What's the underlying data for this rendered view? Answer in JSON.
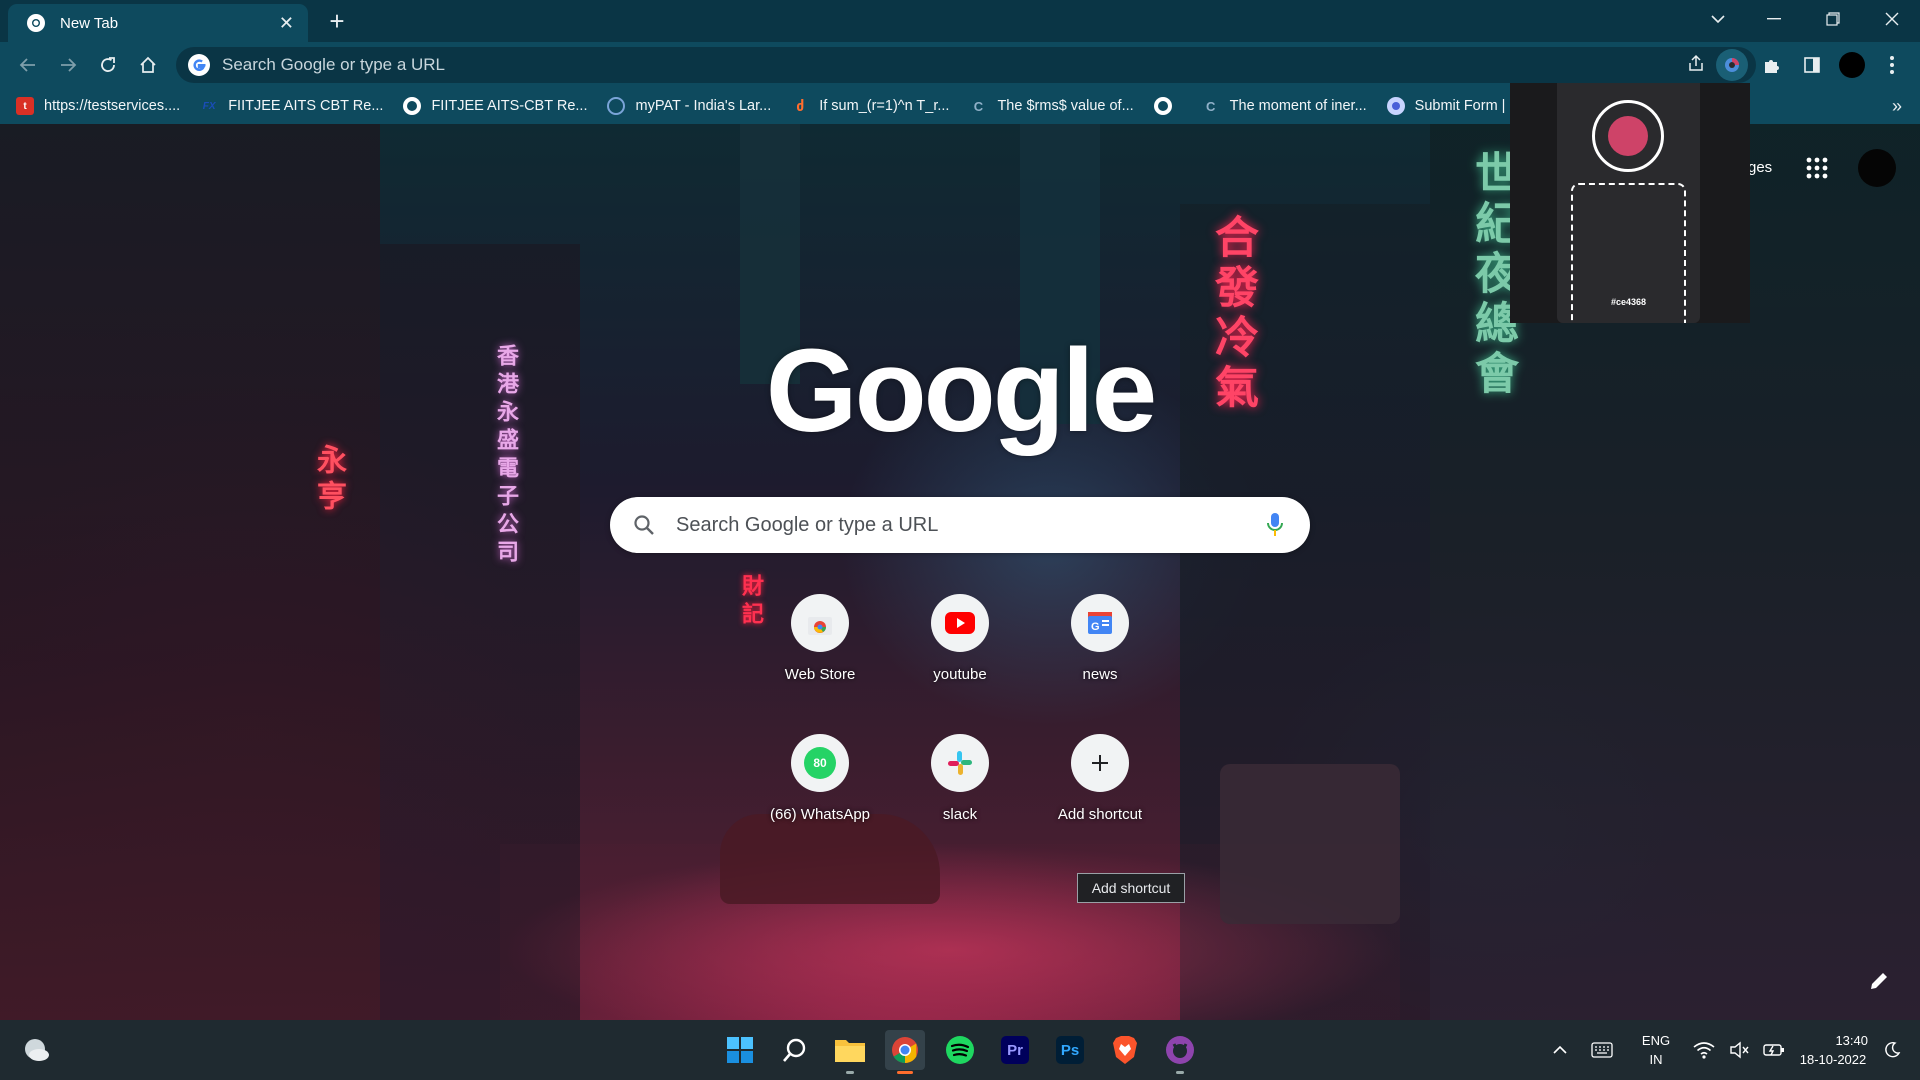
{
  "browser": {
    "tab": {
      "title": "New Tab"
    },
    "omnibox": {
      "placeholder": "Search Google or type a URL"
    },
    "bookmarks": [
      {
        "label": "https://testservices....",
        "icon": "red-doc-icon",
        "color": "#d93025"
      },
      {
        "label": "FIITJEE AITS CBT Re...",
        "icon": "fx-icon",
        "color": "#1a4db8"
      },
      {
        "label": "FIITJEE AITS-CBT Re...",
        "icon": "globe-icon",
        "color": "#ffffff"
      },
      {
        "label": "myPAT - India's Lar...",
        "icon": "mypat-icon",
        "color": "#7aa4d8"
      },
      {
        "label": "If sum_(r=1)^n T_r...",
        "icon": "doubtnut-icon",
        "color": "#ff6d2d"
      },
      {
        "label": "The $rms$ value of...",
        "icon": "quora-icon",
        "color": "#8fb0c8"
      },
      {
        "label": "",
        "icon": "globe-icon",
        "color": "#ffffff"
      },
      {
        "label": "The moment of iner...",
        "icon": "quora-icon",
        "color": "#8fb0c8"
      },
      {
        "label": "Submit Form | S",
        "icon": "form-icon",
        "color": "#c8d4ff"
      }
    ],
    "bookmarks_more": "»"
  },
  "ntp": {
    "logo": "Google",
    "search_placeholder": "Search Google or type a URL",
    "images_link": "ges",
    "shortcuts": [
      {
        "label": "Web Store",
        "icon": "chrome-webstore-icon"
      },
      {
        "label": "youtube",
        "icon": "youtube-icon"
      },
      {
        "label": "news",
        "icon": "google-news-icon"
      },
      {
        "label": "(66) WhatsApp",
        "icon": "whatsapp-icon",
        "badge": "80"
      },
      {
        "label": "slack",
        "icon": "slack-icon"
      },
      {
        "label": "Add shortcut",
        "icon": "plus-icon"
      }
    ],
    "tooltip": "Add shortcut"
  },
  "extension_popup": {
    "record_color": "#ce4368",
    "swatch_label": "#ce4368"
  },
  "taskbar": {
    "apps": [
      "start-icon",
      "search-icon",
      "file-explorer-icon",
      "chrome-icon",
      "spotify-icon",
      "premiere-pro-icon",
      "photoshop-icon",
      "brave-icon",
      "github-desktop-icon"
    ],
    "premiere_label": "Pr",
    "photoshop_label": "Ps",
    "language": {
      "line1": "ENG",
      "line2": "IN"
    },
    "clock": {
      "time": "13:40",
      "date": "18-10-2022"
    }
  },
  "colors": {
    "tab_bar": "#0a3545",
    "toolbar": "#0e4a5e",
    "accent": "#ce4368"
  }
}
